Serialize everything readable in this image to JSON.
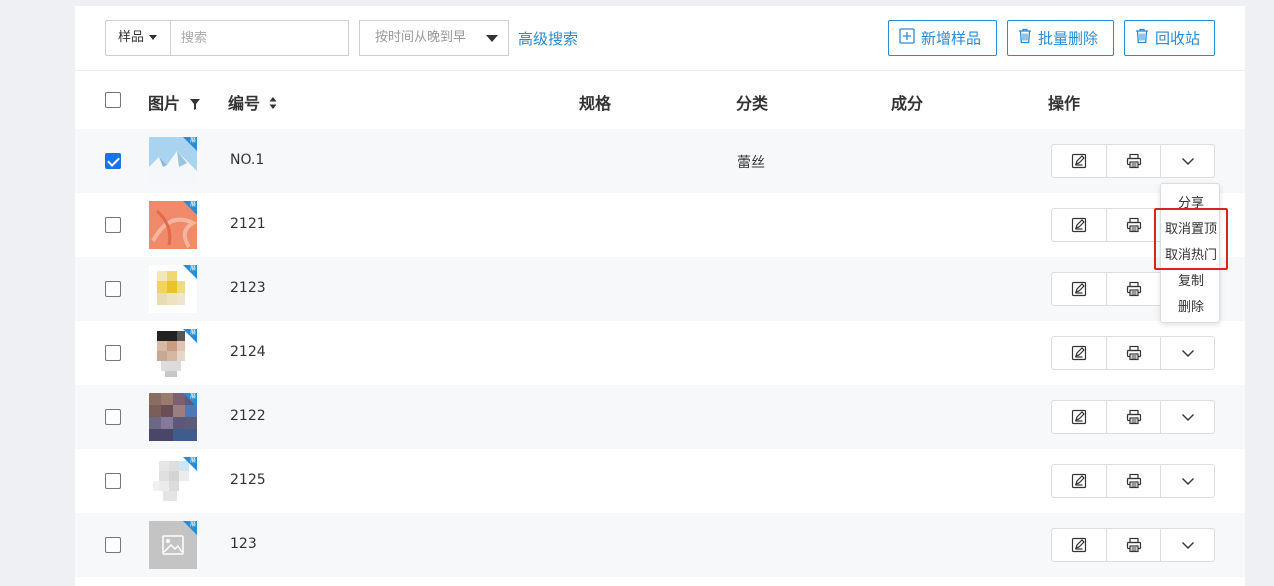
{
  "toolbar": {
    "type_select": "样品",
    "search_placeholder": "搜索",
    "sort_select": "按时间从晚到早",
    "advanced_search": "高级搜索",
    "add_button": "新增样品",
    "batch_delete_button": "批量删除",
    "recycle_button": "回收站"
  },
  "table": {
    "headers": {
      "image": "图片",
      "code": "编号",
      "spec": "规格",
      "category": "分类",
      "composition": "成分",
      "actions": "操作"
    },
    "rows": [
      {
        "code": "NO.1",
        "category": "蕾丝",
        "checked": true
      },
      {
        "code": "2121",
        "category": "",
        "checked": false
      },
      {
        "code": "2123",
        "category": "",
        "checked": false
      },
      {
        "code": "2124",
        "category": "",
        "checked": false
      },
      {
        "code": "2122",
        "category": "",
        "checked": false
      },
      {
        "code": "2125",
        "category": "",
        "checked": false
      },
      {
        "code": "123",
        "category": "",
        "checked": false
      }
    ],
    "thumb_badge": "展"
  },
  "dropdown_menu": {
    "items": [
      "分享",
      "取消置顶",
      "取消热门",
      "复制",
      "删除"
    ]
  },
  "colors": {
    "accent": "#2a8bd2",
    "checkbox_checked": "#1a73e8",
    "highlight": "#d9231e"
  }
}
